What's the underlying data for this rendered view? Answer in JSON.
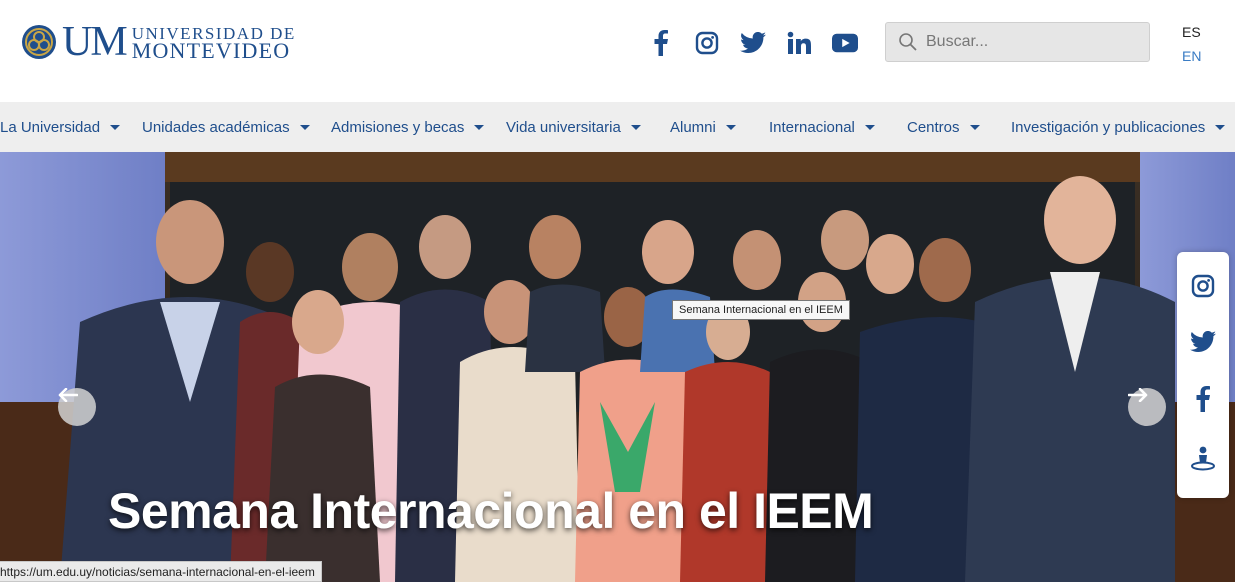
{
  "logo": {
    "abbr": "UM",
    "line1": "UNIVERSIDAD DE",
    "line2": "MONTEVIDEO"
  },
  "social_icons": [
    "facebook-icon",
    "instagram-icon",
    "twitter-icon",
    "linkedin-icon",
    "youtube-icon"
  ],
  "search": {
    "placeholder": "Buscar..."
  },
  "languages": {
    "es": "ES",
    "en": "EN"
  },
  "nav": {
    "items": [
      {
        "label": "La Universidad"
      },
      {
        "label": "Unidades académicas"
      },
      {
        "label": "Admisiones y becas"
      },
      {
        "label": "Vida universitaria"
      },
      {
        "label": "Alumni"
      },
      {
        "label": "Internacional"
      },
      {
        "label": "Centros"
      },
      {
        "label": "Investigación y publicaciones"
      }
    ]
  },
  "hero": {
    "title": "Semana Internacional en el IEEM",
    "tooltip": "Semana Internacional en el IEEM"
  },
  "share_icons": [
    "instagram-icon",
    "twitter-icon",
    "facebook-icon",
    "accessibility-icon"
  ],
  "status_url": "https://um.edu.uy/noticias/semana-internacional-en-el-ieem",
  "colors": {
    "brand": "#1f4e8c",
    "nav_bg": "#eeeeee",
    "accent": "#3a7cc4"
  }
}
